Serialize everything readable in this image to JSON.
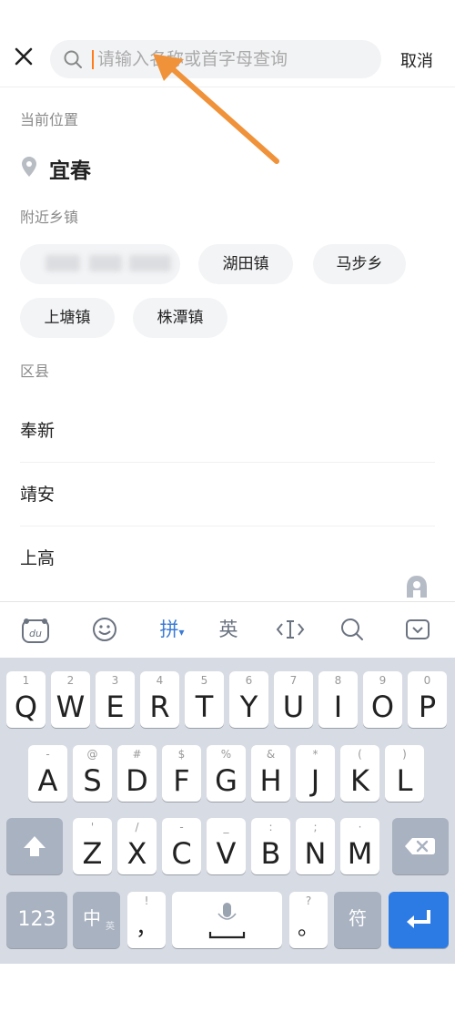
{
  "search": {
    "placeholder": "请输入名称或首字母查询",
    "cancel_label": "取消"
  },
  "current_location": {
    "title": "当前位置",
    "name": "宜春"
  },
  "nearby": {
    "title": "附近乡镇",
    "chips": [
      "湖田镇",
      "马步乡",
      "上塘镇",
      "株潭镇"
    ]
  },
  "districts": {
    "title": "区县",
    "items": [
      "奉新",
      "靖安",
      "上高"
    ]
  },
  "keyboard": {
    "toolbar": {
      "pinyin_label": "拼",
      "english_label": "英"
    },
    "row1": [
      {
        "letter": "Q",
        "sub": "1"
      },
      {
        "letter": "W",
        "sub": "2"
      },
      {
        "letter": "E",
        "sub": "3"
      },
      {
        "letter": "R",
        "sub": "4"
      },
      {
        "letter": "T",
        "sub": "5"
      },
      {
        "letter": "Y",
        "sub": "6"
      },
      {
        "letter": "U",
        "sub": "7"
      },
      {
        "letter": "I",
        "sub": "8"
      },
      {
        "letter": "O",
        "sub": "9"
      },
      {
        "letter": "P",
        "sub": "0"
      }
    ],
    "row2": [
      {
        "letter": "A",
        "sub": "-"
      },
      {
        "letter": "S",
        "sub": "@"
      },
      {
        "letter": "D",
        "sub": "#"
      },
      {
        "letter": "F",
        "sub": "$"
      },
      {
        "letter": "G",
        "sub": "%"
      },
      {
        "letter": "H",
        "sub": "&"
      },
      {
        "letter": "J",
        "sub": "*"
      },
      {
        "letter": "K",
        "sub": "("
      },
      {
        "letter": "L",
        "sub": ")"
      }
    ],
    "row3": [
      {
        "letter": "Z",
        "sub": "'"
      },
      {
        "letter": "X",
        "sub": "/"
      },
      {
        "letter": "C",
        "sub": "-"
      },
      {
        "letter": "V",
        "sub": "_"
      },
      {
        "letter": "B",
        "sub": ":"
      },
      {
        "letter": "N",
        "sub": ";"
      },
      {
        "letter": "M",
        "sub": "·"
      }
    ],
    "bottom": {
      "num_label": "123",
      "zh_label": "中",
      "zh_sub": "英",
      "comma_label": "，",
      "comma_sub": "!",
      "period_label": "。",
      "period_sub": "?",
      "symbols_label": "符"
    }
  },
  "colors": {
    "accent": "#2c7be5",
    "annotation": "#f0923a",
    "caret": "#ff7a1a"
  }
}
